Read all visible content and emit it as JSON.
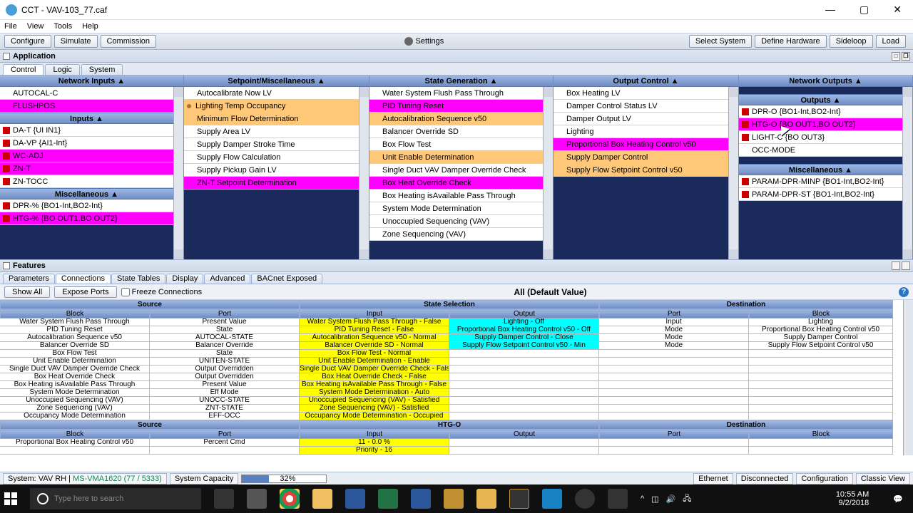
{
  "titlebar": {
    "title": "CCT - VAV-103_77.caf"
  },
  "menubar": {
    "file": "File",
    "view": "View",
    "tools": "Tools",
    "help": "Help"
  },
  "toolbar": {
    "configure": "Configure",
    "simulate": "Simulate",
    "commission": "Commission",
    "settings": "Settings",
    "select_system": "Select System",
    "define_hardware": "Define Hardware",
    "sideloop": "Sideloop",
    "load": "Load"
  },
  "app_header": "Application",
  "tabs": {
    "control": "Control",
    "logic": "Logic",
    "system": "System"
  },
  "cols": {
    "net_in": "Network Inputs ▲",
    "setpt": "Setpoint/Miscellaneous ▲",
    "state": "State Generation ▲",
    "output": "Output Control ▲",
    "net_out": "Network Outputs ▲",
    "inputs": "Inputs ▲",
    "misc": "Miscellaneous ▲",
    "outputs": "Outputs ▲",
    "misc2": "Miscellaneous ▲"
  },
  "c1": {
    "r0": "AUTOCAL-C",
    "r1": "FLUSHPOS",
    "r2": "DA-T {UI IN1}",
    "r3": "DA-VP {AI1-Int}",
    "r4": "WC-ADJ",
    "r5": "ZN-T",
    "r6": "ZN-TOCC",
    "r7": "DPR-% {BO1-Int,BO2-Int}",
    "r8": "HTG-% {BO OUT1,BO OUT2}"
  },
  "c2": {
    "r0": "Autocalibrate Now LV",
    "r1": "Lighting Temp Occupancy",
    "r2": "Minimum Flow Determination",
    "r3": "Supply Area LV",
    "r4": "Supply Damper Stroke Time",
    "r5": "Supply Flow Calculation",
    "r6": "Supply Pickup Gain LV",
    "r7": "ZN-T Setpoint Determination"
  },
  "c3": {
    "r0": "Water System Flush Pass Through",
    "r1": "PID Tuning Reset",
    "r2": "Autocalibration Sequence v50",
    "r3": "Balancer Override SD",
    "r4": "Box Flow Test",
    "r5": "Unit Enable Determination",
    "r6": "Single Duct VAV Damper Override Check",
    "r7": "Box Heat Override Check",
    "r8": "Box Heating isAvailable Pass Through",
    "r9": "System Mode Determination",
    "r10": "Unoccupied Sequencing (VAV)",
    "r11": "Zone Sequencing (VAV)"
  },
  "c4": {
    "r0": "Box Heating LV",
    "r1": "Damper Control Status LV",
    "r2": "Damper Output LV",
    "r3": "Lighting",
    "r4": "Proportional Box Heating Control v50",
    "r5": "Supply Damper Control",
    "r6": "Supply Flow Setpoint Control v50"
  },
  "c5": {
    "r0": "DPR-O {BO1-Int,BO2-Int}",
    "r1": "HTG-O {BO OUT1,BO OUT2}",
    "r2": "LIGHT-C {BO OUT3}",
    "r3": "OCC-MODE",
    "r4": "PARAM-DPR-MINP {BO1-Int,BO2-Int}",
    "r5": "PARAM-DPR-ST {BO1-Int,BO2-Int}"
  },
  "feat": "Features",
  "ftabs": {
    "parameters": "Parameters",
    "connections": "Connections",
    "state_tables": "State Tables",
    "display": "Display",
    "advanced": "Advanced",
    "bacnet": "BACnet Exposed"
  },
  "fbar": {
    "show_all": "Show All",
    "expose_ports": "Expose Ports",
    "freeze": "Freeze Connections",
    "title": "All (Default Value)"
  },
  "ghdr": {
    "source": "Source",
    "state_sel": "State Selection",
    "dest": "Destination",
    "block": "Block",
    "port": "Port",
    "input": "Input",
    "output": "Output",
    "htgo": "HTG-O"
  },
  "grid1": [
    {
      "b": "Water System Flush Pass Through",
      "p": "Present Value",
      "i": "Water System Flush Pass Through - False",
      "o": "Lighting - Off",
      "dp": "Input",
      "db": "Lighting"
    },
    {
      "b": "PID Tuning Reset",
      "p": "State",
      "i": "PID Tuning Reset - False",
      "o": "Proportional Box Heating Control v50 - Off",
      "dp": "Mode",
      "db": "Proportional Box Heating Control v50"
    },
    {
      "b": "Autocalibration Sequence v50",
      "p": "AUTOCAL-STATE",
      "i": "Autocalibration Sequence v50 - Normal",
      "o": "Supply Damper Control - Close",
      "dp": "Mode",
      "db": "Supply Damper Control"
    },
    {
      "b": "Balancer Override SD",
      "p": "Balancer Override",
      "i": "Balancer Override SD - Normal",
      "o": "Supply Flow Setpoint Control v50 - Min",
      "dp": "Mode",
      "db": "Supply Flow Setpoint Control v50"
    },
    {
      "b": "Box Flow Test",
      "p": "State",
      "i": "Box Flow Test - Normal",
      "o": "",
      "dp": "",
      "db": ""
    },
    {
      "b": "Unit Enable Determination",
      "p": "UNITEN-STATE",
      "i": "Unit Enable Determination - Enable",
      "o": "",
      "dp": "",
      "db": ""
    },
    {
      "b": "Single Duct VAV Damper Override Check",
      "p": "Output Overridden",
      "i": "Single Duct VAV Damper Override Check - False",
      "o": "",
      "dp": "",
      "db": ""
    },
    {
      "b": "Box Heat Override Check",
      "p": "Output Overridden",
      "i": "Box Heat Override Check - False",
      "o": "",
      "dp": "",
      "db": ""
    },
    {
      "b": "Box Heating isAvailable Pass Through",
      "p": "Present Value",
      "i": "Box Heating isAvailable Pass Through - False",
      "o": "",
      "dp": "",
      "db": ""
    },
    {
      "b": "System Mode Determination",
      "p": "Eff Mode",
      "i": "System Mode Determination - Auto",
      "o": "",
      "dp": "",
      "db": ""
    },
    {
      "b": "Unoccupied Sequencing (VAV)",
      "p": "UNOCC-STATE",
      "i": "Unoccupied Sequencing (VAV) - Satisfied",
      "o": "",
      "dp": "",
      "db": ""
    },
    {
      "b": "Zone Sequencing (VAV)",
      "p": "ZNT-STATE",
      "i": "Zone Sequencing (VAV) - Satisfied",
      "o": "",
      "dp": "",
      "db": ""
    },
    {
      "b": "Occupancy Mode Determination",
      "p": "EFF-OCC",
      "i": "Occupancy Mode Determination - Occupied",
      "o": "",
      "dp": "",
      "db": ""
    }
  ],
  "grid2": [
    {
      "b": "Proportional Box Heating Control v50",
      "p": "Percent Cmd",
      "i": "11 - 0.0 %",
      "o": "",
      "dp": "",
      "db": ""
    },
    {
      "b": "",
      "p": "",
      "i": "Priority - 16",
      "o": "",
      "dp": "",
      "db": ""
    }
  ],
  "status": {
    "sys": "System: VAV RH",
    "ms": "MS-VMA1620 (77 / 5333)",
    "cap": "System Capacity",
    "pct": "32%",
    "eth": "Ethernet",
    "disc": "Disconnected",
    "conf": "Configuration",
    "classic": "Classic View"
  },
  "taskbar": {
    "search": "Type here to search",
    "time": "10:55 AM",
    "date": "9/2/2018"
  }
}
